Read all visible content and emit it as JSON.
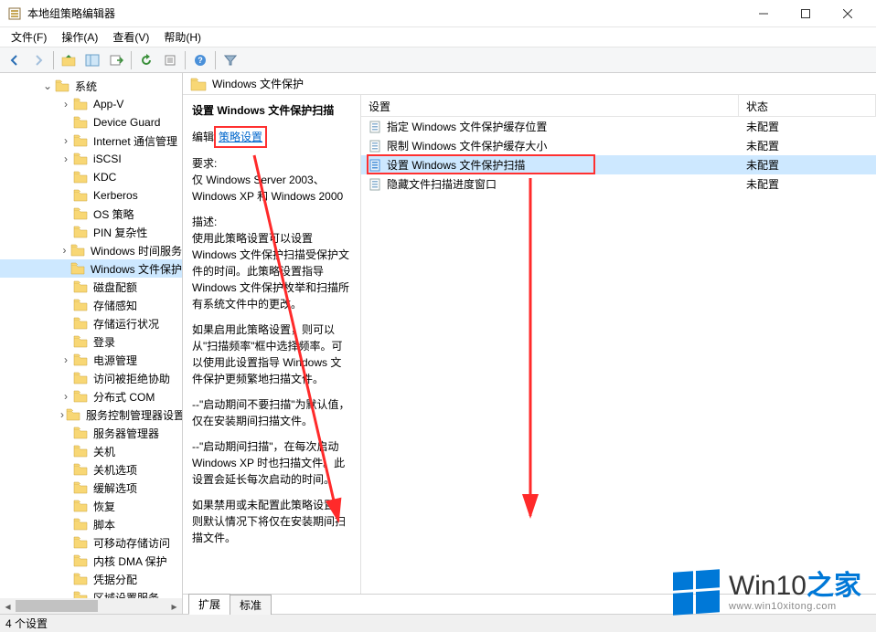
{
  "window": {
    "title": "本地组策略编辑器",
    "minimize": "最小化",
    "maximize": "最大化",
    "close": "关闭"
  },
  "menu": {
    "file": "文件(F)",
    "action": "操作(A)",
    "view": "查看(V)",
    "help": "帮助(H)"
  },
  "toolbar_icons": [
    "back",
    "forward",
    "up",
    "show-hide-tree",
    "export-list",
    "refresh",
    "properties",
    "help",
    "filter"
  ],
  "tree": {
    "root": {
      "label": "系统",
      "expanded": true
    },
    "items": [
      {
        "label": "App-V",
        "expander": ">"
      },
      {
        "label": "Device Guard"
      },
      {
        "label": "Internet 通信管理",
        "expander": ">"
      },
      {
        "label": "iSCSI",
        "expander": ">"
      },
      {
        "label": "KDC"
      },
      {
        "label": "Kerberos"
      },
      {
        "label": "OS 策略"
      },
      {
        "label": "PIN 复杂性"
      },
      {
        "label": "Windows 时间服务",
        "expander": ">"
      },
      {
        "label": "Windows 文件保护",
        "selected": true
      },
      {
        "label": "磁盘配额"
      },
      {
        "label": "存储感知"
      },
      {
        "label": "存储运行状况"
      },
      {
        "label": "登录"
      },
      {
        "label": "电源管理",
        "expander": ">"
      },
      {
        "label": "访问被拒绝协助"
      },
      {
        "label": "分布式 COM",
        "expander": ">"
      },
      {
        "label": "服务控制管理器设置",
        "expander": ">"
      },
      {
        "label": "服务器管理器"
      },
      {
        "label": "关机"
      },
      {
        "label": "关机选项"
      },
      {
        "label": "缓解选项"
      },
      {
        "label": "恢复"
      },
      {
        "label": "脚本"
      },
      {
        "label": "可移动存储访问"
      },
      {
        "label": "内核 DMA 保护"
      },
      {
        "label": "凭据分配"
      },
      {
        "label": "区域设置服务"
      }
    ]
  },
  "content": {
    "header_title": "Windows 文件保护",
    "details": {
      "title": "设置 Windows 文件保护扫描",
      "edit_label": "编辑",
      "edit_link": "策略设置",
      "req_label": "要求:",
      "req_text": "仅 Windows Server 2003、Windows XP 和 Windows 2000",
      "desc_label": "描述:",
      "desc_p1": "使用此策略设置可以设置 Windows 文件保护扫描受保护文件的时间。此策略设置指导 Windows 文件保护枚举和扫描所有系统文件中的更改。",
      "desc_p2": "如果启用此策略设置，则可以从\"扫描频率\"框中选择频率。可以使用此设置指导 Windows 文件保护更频繁地扫描文件。",
      "desc_p3": "--\"启动期间不要扫描\"为默认值，仅在安装期间扫描文件。",
      "desc_p4": "--\"启动期间扫描\"，在每次启动 Windows XP 时也扫描文件。此设置会延长每次启动的时间。",
      "desc_p5": "如果禁用或未配置此策略设置，则默认情况下将仅在安装期间扫描文件。"
    },
    "columns": {
      "setting": "设置",
      "status": "状态"
    },
    "rows": [
      {
        "label": "指定 Windows 文件保护缓存位置",
        "status": "未配置",
        "selected": false
      },
      {
        "label": "限制 Windows 文件保护缓存大小",
        "status": "未配置",
        "selected": false
      },
      {
        "label": "设置 Windows 文件保护扫描",
        "status": "未配置",
        "selected": true,
        "highlight": true
      },
      {
        "label": "隐藏文件扫描进度窗口",
        "status": "未配置",
        "selected": false
      }
    ],
    "tabs": {
      "extended": "扩展",
      "standard": "标准"
    }
  },
  "statusbar": {
    "text": "4 个设置"
  },
  "watermark": {
    "brand_a": "Win10",
    "brand_b": "之家",
    "url": "www.win10xitong.com"
  }
}
